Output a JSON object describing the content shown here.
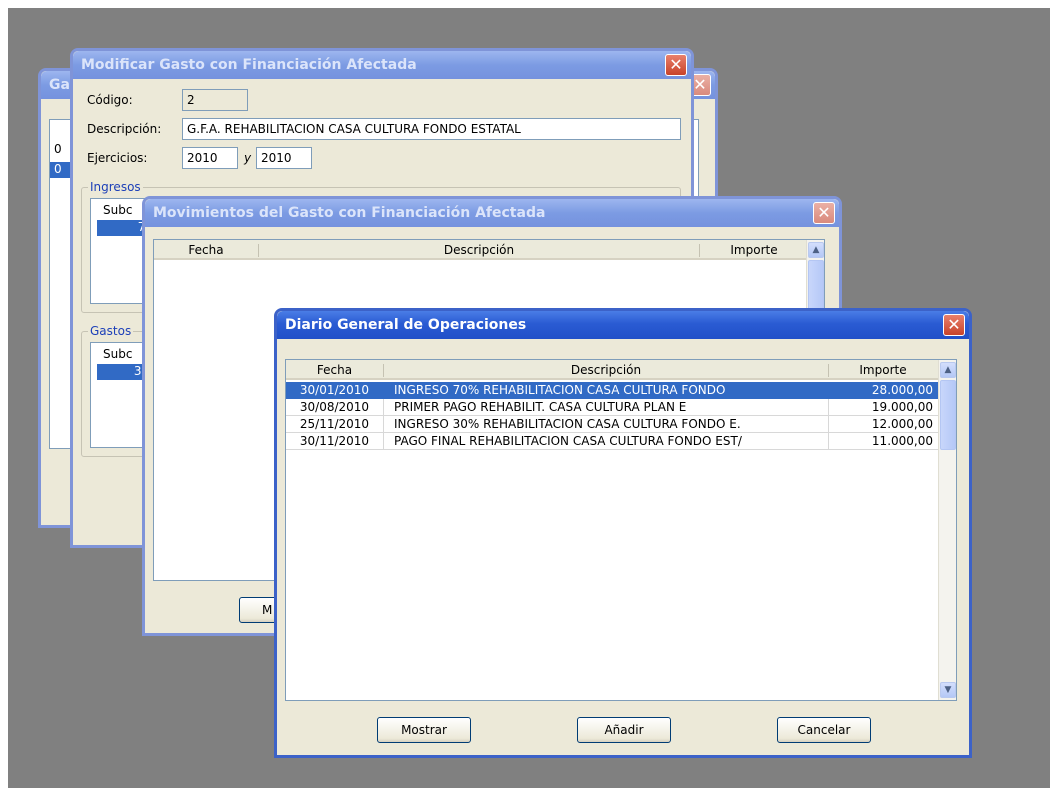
{
  "window_ga": {
    "title": "Ga"
  },
  "window_modificar": {
    "title": "Modificar Gasto con Financiación Afectada",
    "close": "✕",
    "codigo_label": "Código:",
    "codigo_value": "2",
    "descripcion_label": "Descripción:",
    "descripcion_value": "G.F.A. REHABILITACION CASA CULTURA FONDO ESTATAL",
    "ejercicios_label": "Ejercicios:",
    "ejercicio_desde": "2010",
    "y_label": "y",
    "ejercicio_hasta": "2010",
    "ingresos_group": "Ingresos",
    "ingresos_sub_header": "Subc",
    "ingresos_sub_value": "72",
    "gastos_group": "Gastos",
    "gastos_sub_header": "Subc",
    "gastos_sub_value": "3 6",
    "back_row_a": "0",
    "back_row_b": "0"
  },
  "window_movimientos": {
    "title": "Movimientos del Gasto con Financiación Afectada",
    "close": "✕",
    "columns": [
      "Fecha",
      "Descripción",
      "Importe"
    ],
    "bottom_button": "M"
  },
  "window_diario": {
    "title": "Diario General de Operaciones",
    "close": "✕",
    "columns": [
      "Fecha",
      "Descripción",
      "Importe"
    ],
    "rows": [
      {
        "fecha": "30/01/2010",
        "descripcion": "INGRESO 70% REHABILITACION CASA CULTURA FONDO",
        "importe": "28.000,00"
      },
      {
        "fecha": "30/08/2010",
        "descripcion": "PRIMER PAGO REHABILIT. CASA CULTURA PLAN E",
        "importe": "19.000,00"
      },
      {
        "fecha": "25/11/2010",
        "descripcion": "INGRESO 30% REHABILITACION CASA CULTURA FONDO E.",
        "importe": "12.000,00"
      },
      {
        "fecha": "30/11/2010",
        "descripcion": "PAGO FINAL REHABILITACION CASA CULTURA FONDO EST/",
        "importe": "11.000,00"
      }
    ],
    "buttons": {
      "mostrar": "Mostrar",
      "anadir": "Añadir",
      "cancelar": "Cancelar"
    }
  },
  "colors": {
    "desktop": "#808080",
    "titlebar_active": "#2a5bd3",
    "selection": "#316ac5",
    "window_face": "#ece9d8"
  },
  "icons": {
    "close": "close-icon",
    "scroll_up": "scroll-up-arrow-icon",
    "scroll_down": "scroll-down-arrow-icon"
  }
}
